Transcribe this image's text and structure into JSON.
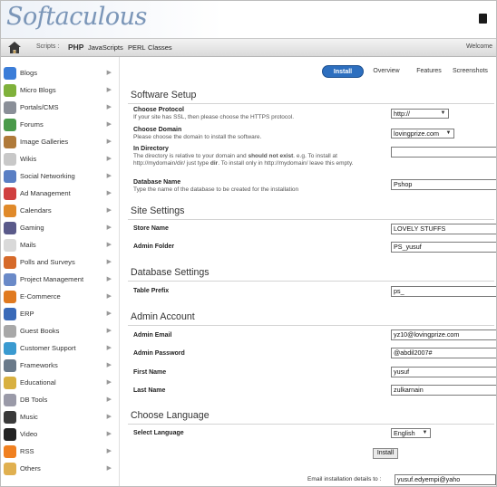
{
  "header": {
    "logo": "Softaculous"
  },
  "toolbar": {
    "scripts_label": "Scripts :",
    "links": [
      "PHP",
      "JavaScripts",
      "PERL",
      "Classes"
    ],
    "welcome": "Welcome"
  },
  "sidebar": {
    "items": [
      {
        "label": "Blogs",
        "color": "#3b7dd8",
        "icon": "user-icon"
      },
      {
        "label": "Micro Blogs",
        "color": "#7fb13b",
        "icon": "micro-blog-icon"
      },
      {
        "label": "Portals/CMS",
        "color": "#8a8f98",
        "icon": "portal-icon"
      },
      {
        "label": "Forums",
        "color": "#4a9a4a",
        "icon": "forum-icon"
      },
      {
        "label": "Image Galleries",
        "color": "#b07a3a",
        "icon": "gallery-icon"
      },
      {
        "label": "Wikis",
        "color": "#c8c8c8",
        "icon": "wiki-icon"
      },
      {
        "label": "Social Networking",
        "color": "#5a7fc4",
        "icon": "social-icon"
      },
      {
        "label": "Ad Management",
        "color": "#d04040",
        "icon": "ad-icon"
      },
      {
        "label": "Calendars",
        "color": "#e08a2a",
        "icon": "calendar-icon"
      },
      {
        "label": "Gaming",
        "color": "#5a5a8a",
        "icon": "gamepad-icon"
      },
      {
        "label": "Mails",
        "color": "#d9d9d9",
        "icon": "mail-icon"
      },
      {
        "label": "Polls and Surveys",
        "color": "#d66a2a",
        "icon": "poll-icon"
      },
      {
        "label": "Project Management",
        "color": "#6a8ac8",
        "icon": "project-icon"
      },
      {
        "label": "E-Commerce",
        "color": "#e07a20",
        "icon": "cart-icon"
      },
      {
        "label": "ERP",
        "color": "#3a6ab8",
        "icon": "erp-icon"
      },
      {
        "label": "Guest Books",
        "color": "#a8a8a8",
        "icon": "guestbook-icon"
      },
      {
        "label": "Customer Support",
        "color": "#3a9ad0",
        "icon": "support-icon"
      },
      {
        "label": "Frameworks",
        "color": "#6a7a8a",
        "icon": "framework-icon"
      },
      {
        "label": "Educational",
        "color": "#d8b040",
        "icon": "education-icon"
      },
      {
        "label": "DB Tools",
        "color": "#9a9aa8",
        "icon": "database-icon"
      },
      {
        "label": "Music",
        "color": "#3a3a3a",
        "icon": "music-icon"
      },
      {
        "label": "Video",
        "color": "#222222",
        "icon": "video-icon"
      },
      {
        "label": "RSS",
        "color": "#f08020",
        "icon": "rss-icon"
      },
      {
        "label": "Others",
        "color": "#e0b050",
        "icon": "folder-icon"
      }
    ]
  },
  "tabs": {
    "install": "Install",
    "overview": "Overview",
    "features": "Features",
    "screenshots": "Screenshots"
  },
  "sections": {
    "software_setup": "Software Setup",
    "site_settings": "Site Settings",
    "database_settings": "Database Settings",
    "admin_account": "Admin Account",
    "choose_language": "Choose Language"
  },
  "fields": {
    "protocol": {
      "label": "Choose Protocol",
      "desc": "If your site has SSL, then please choose the HTTPS protocol.",
      "value": "http://"
    },
    "domain": {
      "label": "Choose Domain",
      "desc": "Please choose the domain to install the software.",
      "value": "lovingprize.com"
    },
    "directory": {
      "label": "In Directory",
      "desc_a": "The directory is relative to your domain and ",
      "desc_b": "should not exist",
      "desc_c": ". e.g. To install at http://mydomain/dir/ just type ",
      "desc_d": "dir",
      "desc_e": ". To install only in http://mydomain/ leave this empty.",
      "value": ""
    },
    "db_name": {
      "label": "Database Name",
      "desc": "Type the name of the database to be created for the installation",
      "value": "Pshop"
    },
    "store_name": {
      "label": "Store Name",
      "value": "LOVELY STUFFS"
    },
    "admin_folder": {
      "label": "Admin Folder",
      "value": "PS_yusuf"
    },
    "table_prefix": {
      "label": "Table Prefix",
      "value": "ps_"
    },
    "admin_email": {
      "label": "Admin Email",
      "value": "yz10@lovingprize.com"
    },
    "admin_password": {
      "label": "Admin Password",
      "value": "@abdil2007#"
    },
    "first_name": {
      "label": "First Name",
      "value": "yusuf"
    },
    "last_name": {
      "label": "Last Name",
      "value": "zulkarnain"
    },
    "language": {
      "label": "Select Language",
      "value": "English"
    }
  },
  "install_button": "Install",
  "email_note": {
    "label": "Email installation details to :",
    "value": "yusuf.edyempi@yaho"
  }
}
